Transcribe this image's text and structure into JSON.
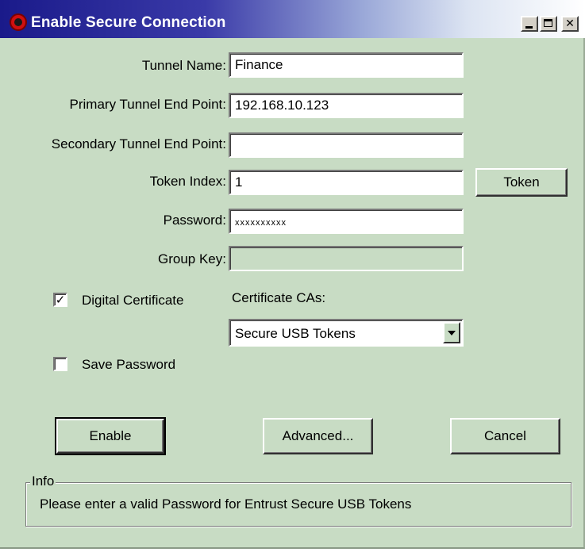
{
  "window": {
    "title": "Enable Secure Connection"
  },
  "form": {
    "tunnel_name": {
      "label": "Tunnel Name:",
      "value": "Finance"
    },
    "primary_endpoint": {
      "label": "Primary Tunnel End Point:",
      "value": "192.168.10.123"
    },
    "secondary_endpoint": {
      "label": "Secondary Tunnel End Point:",
      "value": ""
    },
    "token_index": {
      "label": "Token Index:",
      "value": "1"
    },
    "password": {
      "label": "Password:",
      "value": "xxxxxxxxxx"
    },
    "group_key": {
      "label": "Group Key:",
      "value": "",
      "enabled": false
    }
  },
  "token_button": {
    "label": "Token"
  },
  "digital_certificate": {
    "label": "Digital Certificate",
    "checked": true
  },
  "save_password": {
    "label": "Save Password",
    "checked": false
  },
  "certificate_cas": {
    "label": "Certificate CAs:",
    "selected": "Secure USB Tokens"
  },
  "buttons": {
    "enable": "Enable",
    "advanced": "Advanced...",
    "cancel": "Cancel"
  },
  "info": {
    "legend": "Info",
    "message": "Please enter a valid Password for Entrust Secure USB Tokens"
  },
  "colors": {
    "dialog_background": "#c8dcc4",
    "titlebar_start": "#1a1a8a",
    "titlebar_end": "#ffffff",
    "title_icon": "#d01010"
  }
}
